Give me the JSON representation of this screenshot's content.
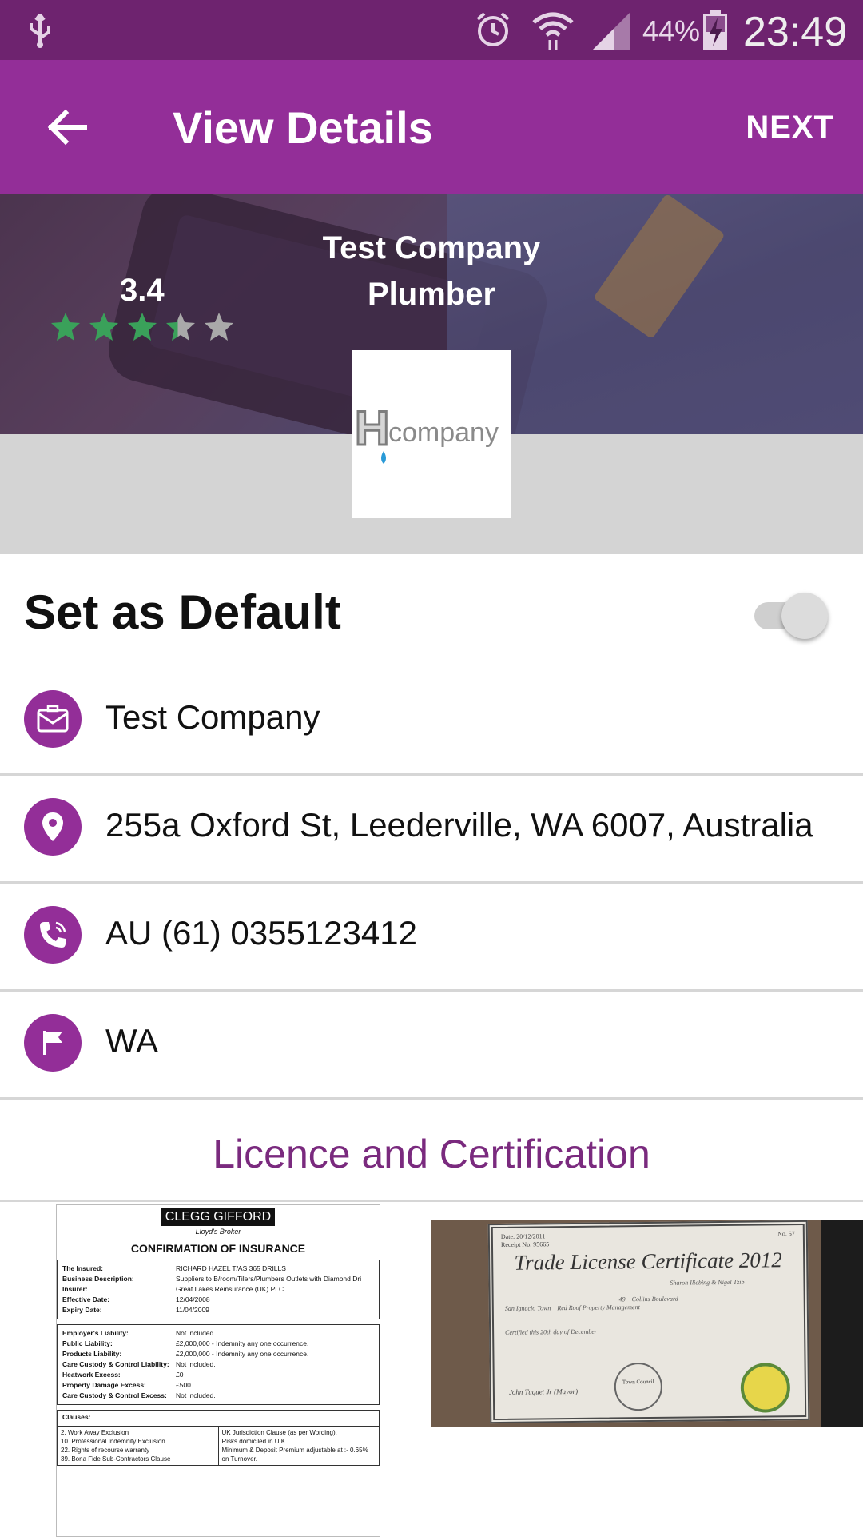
{
  "status_bar": {
    "battery_percent": "44%",
    "time": "23:49",
    "icons": [
      "usb-icon",
      "alarm-icon",
      "wifi-icon",
      "signal-icon",
      "battery-charging-icon"
    ]
  },
  "app_bar": {
    "title": "View Details",
    "next_label": "NEXT"
  },
  "hero": {
    "company_line1": "Test Company",
    "company_line2": "Plumber",
    "rating_text": "3.4",
    "rating_value": 3.4,
    "rating_max": 5,
    "star_color": "#3aa15a"
  },
  "logo": {
    "brand_text": "company",
    "letter": "H"
  },
  "default": {
    "label": "Set as Default",
    "enabled": false
  },
  "details": {
    "company": "Test Company",
    "address": "255a Oxford St, Leederville, WA 6007, Australia",
    "phone": "AU (61) 0355123412",
    "state": "WA"
  },
  "section": {
    "title": "Licence and Certification"
  },
  "insurance_doc": {
    "brand": "CLEGG GIFFORD",
    "broker": "Lloyd's Broker",
    "heading": "CONFIRMATION OF INSURANCE",
    "rows_top": [
      {
        "k": "The Insured:",
        "v": "RICHARD HAZEL T/AS 365 DRILLS"
      },
      {
        "k": "Business Description:",
        "v": "Suppliers to B/room/Tilers/Plumbers Outlets with Diamond Dri"
      },
      {
        "k": "Insurer:",
        "v": "Great Lakes Reinsurance (UK) PLC"
      },
      {
        "k": "Effective Date:",
        "v": "12/04/2008"
      },
      {
        "k": "Expiry Date:",
        "v": "11/04/2009"
      }
    ],
    "rows_mid": [
      {
        "k": "Employer's Liability:",
        "v": "Not included."
      },
      {
        "k": "Public Liability:",
        "v": "£2,000,000 - Indemnity any one occurrence."
      },
      {
        "k": "Products Liability:",
        "v": "£2,000,000 - Indemnity any one occurrence."
      },
      {
        "k": "Care Custody & Control Liability:",
        "v": "Not included."
      },
      {
        "k": "Heatwork Excess:",
        "v": "£0"
      },
      {
        "k": "Property Damage Excess:",
        "v": "£500"
      },
      {
        "k": "Care Custody & Control Excess:",
        "v": "Not included."
      }
    ],
    "clauses_label": "Clauses:",
    "clauses_left": [
      "2. Work Away Exclusion",
      "10. Professional Indemnity Exclusion",
      "22. Rights of recourse warranty",
      "39. Bona Fide Sub-Contractors Clause"
    ],
    "clauses_right": [
      "UK Jurisdiction Clause (as per Wording).",
      "Risks domiciled in U.K.",
      "Minimum & Deposit Premium adjustable at :- 0.65% on Turnover."
    ]
  },
  "license_doc": {
    "title": "Trade License Certificate 2012",
    "date": "Date: 20/12/2011",
    "receipt": "Receipt No. 95665",
    "number": "No. 57",
    "holder": "Sharon Iliebing & Nigel Tzib",
    "street": "San Ignacio Town",
    "business": "Red Roof Property Management",
    "address_no": "49",
    "address_street": "Collins Boulevard",
    "certified": "Certified this 20th day of December",
    "seal_text": "Town Council",
    "signer": "John Tuquet Jr (Mayor)"
  }
}
